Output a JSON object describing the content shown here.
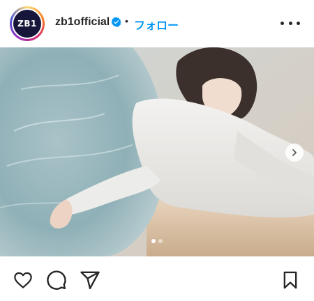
{
  "post": {
    "username": "zb1official",
    "avatar_text": "ZB1",
    "separator": "•",
    "follow_label": "フォロー",
    "verified": true
  },
  "carousel": {
    "slide_count": 2,
    "active_slide": 1
  },
  "icons": {
    "more": "more-options-icon",
    "next": "chevron-right-icon",
    "like": "heart-icon",
    "comment": "comment-icon",
    "share": "paper-plane-icon",
    "save": "bookmark-icon"
  },
  "colors": {
    "accent": "#0095f6",
    "text": "#262626"
  }
}
